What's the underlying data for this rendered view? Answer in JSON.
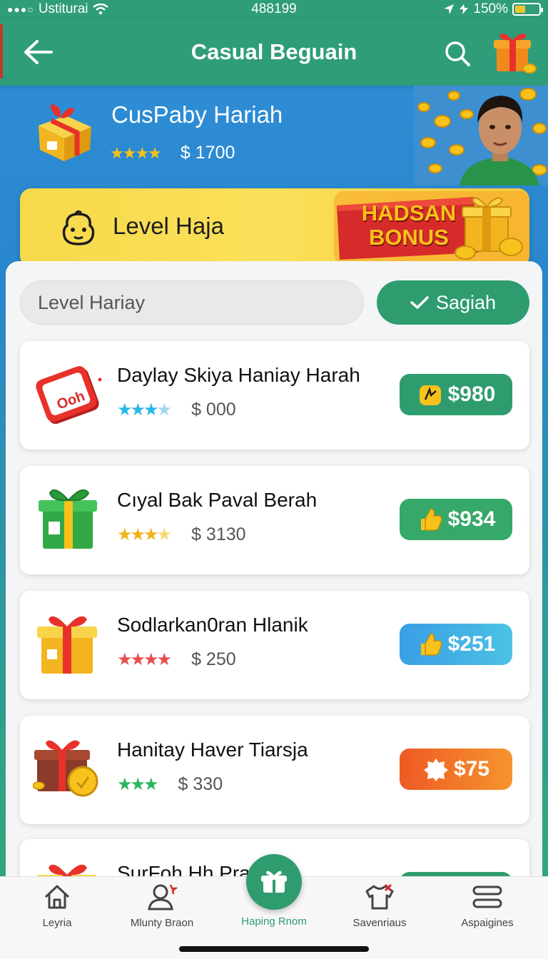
{
  "status_bar": {
    "carrier": "Ustiturai",
    "time": "488199",
    "battery_text": "150%"
  },
  "app_bar": {
    "title": "Casual Beguain"
  },
  "hero": {
    "title": "CusPaby Hariah",
    "rating_stars": 4,
    "price": "$ 1700"
  },
  "level_banner": {
    "label": "Level Haja",
    "bonus_line1": "HADSAN",
    "bonus_line2": "BONUS"
  },
  "filter": {
    "search_placeholder": "Level Hariay",
    "action_label": "Sagiah"
  },
  "items": [
    {
      "name": "Daylay Skiya Haniay Harah",
      "price_note": "$ 000",
      "stars": 4,
      "star_color": "#29b6e8",
      "price": "$980",
      "price_bg": "#2f9c6f",
      "thumb": "red-ticket-icon",
      "thumb_text": "Ooh"
    },
    {
      "name": "Cıyal Bak Paval Berah",
      "price_note": "$ 3130",
      "stars": 4,
      "star_color": "#f0b21a",
      "price": "$934",
      "price_bg": "#35a86a",
      "thumb": "green-gift-icon"
    },
    {
      "name": "Sodlarkan0ran Hlanik",
      "price_note": "$ 250",
      "stars": 4,
      "star_color": "#e84d4d",
      "price": "$251",
      "price_bg": "#3aa8e4",
      "thumb": "yellow-gift-icon"
    },
    {
      "name": "Hanitay Haver Tiarsja",
      "price_note": "$ 330",
      "stars": 3,
      "star_color": "#2cb55c",
      "price": "$75",
      "price_bg": "#f06a2a",
      "thumb": "brown-gift-coin-icon"
    },
    {
      "name": "SurFoh Hh Pra...odh",
      "price_note": "",
      "stars": 0,
      "star_color": "#f0b21a",
      "price": "",
      "price_bg": "#2f9c6f",
      "thumb": "yellow-gift-icon"
    }
  ],
  "bottom_nav": {
    "items": [
      {
        "label": "Leyria",
        "icon": "home-icon"
      },
      {
        "label": "Mlunty Braon",
        "icon": "profile-icon"
      },
      {
        "label": "Haping Rnom",
        "icon": "gift-basket-icon"
      },
      {
        "label": "Savenriaus",
        "icon": "shirt-icon"
      },
      {
        "label": "Aspaigines",
        "icon": "menu-icon"
      }
    ]
  },
  "colors": {
    "primary": "#2f9c6f",
    "banner": "#f7d94a",
    "bonus_red": "#d62b2b",
    "bonus_text": "#f7c21b"
  }
}
